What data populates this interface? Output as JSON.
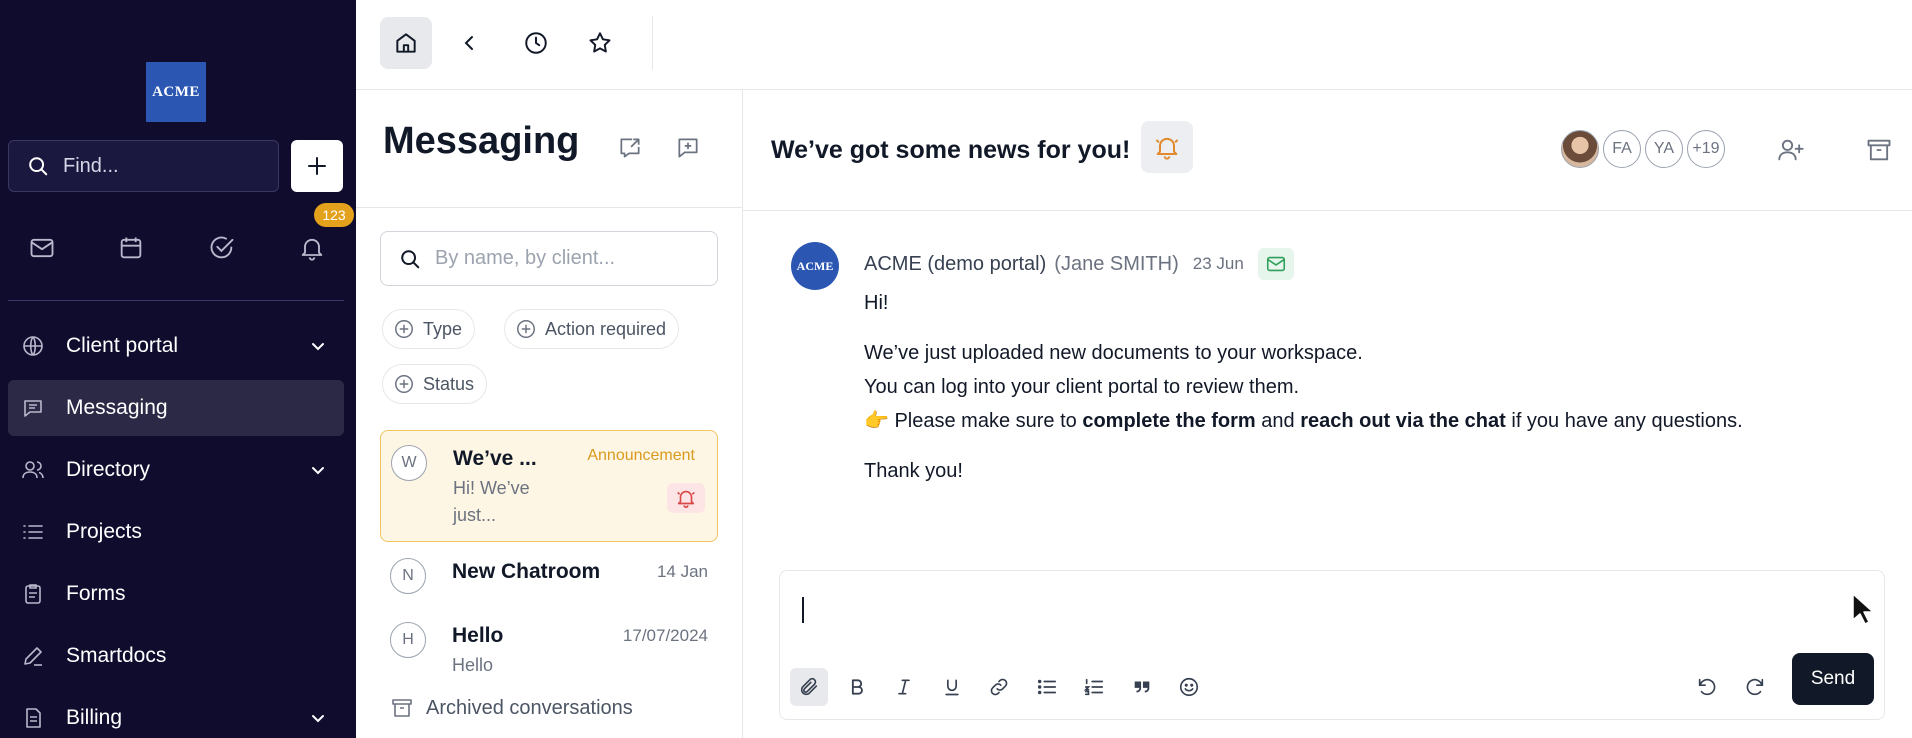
{
  "sidebar": {
    "logo_text": "ACME",
    "find_placeholder": "Find...",
    "notifications_badge": "123",
    "nav": [
      {
        "label": "Client portal",
        "icon": "globe-icon",
        "expandable": true
      },
      {
        "label": "Messaging",
        "icon": "message-icon",
        "active": true
      },
      {
        "label": "Directory",
        "icon": "users-icon",
        "expandable": true
      },
      {
        "label": "Projects",
        "icon": "list-icon"
      },
      {
        "label": "Forms",
        "icon": "clipboard-icon"
      },
      {
        "label": "Smartdocs",
        "icon": "pen-icon"
      },
      {
        "label": "Billing",
        "icon": "document-icon",
        "expandable": true
      }
    ]
  },
  "topbar": {
    "icons": [
      "home-icon",
      "chevron-left-icon",
      "history-icon",
      "star-icon"
    ]
  },
  "conversations": {
    "title": "Messaging",
    "search_placeholder": "By name, by client...",
    "filters": [
      {
        "label": "Type"
      },
      {
        "label": "Action required"
      },
      {
        "label": "Status"
      }
    ],
    "items": [
      {
        "initial": "W",
        "title": "We’ve ...",
        "preview": "Hi! We’ve just...",
        "tag": "Announcement",
        "selected": true
      },
      {
        "initial": "N",
        "title": "New Chatroom",
        "date": "14 Jan"
      },
      {
        "initial": "H",
        "title": "Hello",
        "preview": "Hello",
        "date": "17/07/2024"
      }
    ],
    "archived_label": "Archived conversations"
  },
  "chat": {
    "title": "We’ve got some news for you!",
    "members": [
      "FA",
      "YA",
      "+19"
    ],
    "message": {
      "avatar_text": "ACME",
      "sender": "ACME (demo portal)",
      "person": "(Jane SMITH)",
      "date": "23 Jun",
      "greeting": "Hi!",
      "line1": "We’ve just uploaded new documents to your workspace.",
      "line2": "You can log into your client portal to review them.",
      "line3_emoji": "👉",
      "line3_a": " Please make sure to ",
      "line3_b": "complete the form",
      "line3_c": " and ",
      "line3_d": "reach out via the chat",
      "line3_e": " if you have any questions.",
      "closing": "Thank you!"
    },
    "composer": {
      "send_label": "Send"
    }
  },
  "colors": {
    "sidebar_bg": "#0f0c2e",
    "accent_yellow": "#e4a11b",
    "selected_bg": "#fef6e4",
    "alert_red": "#d94848",
    "bell_orange": "#e08a2c",
    "mail_green": "#2f9e5a",
    "send_bg": "#111827"
  }
}
